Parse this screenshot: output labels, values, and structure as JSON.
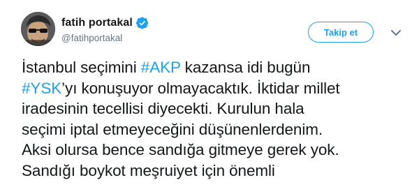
{
  "user": {
    "display_name": "fatih portakal",
    "handle": "@fatihportakal",
    "verified_icon": "verified-badge-icon",
    "avatar_icon": "profile-avatar"
  },
  "actions": {
    "follow_label": "Takip et",
    "more_icon": "chevron-down-icon"
  },
  "tweet": {
    "line1_a": "İstanbul seçimini ",
    "line1_hashtag": "#AKP",
    "line1_b": " kazansa idi bugün",
    "line2_hashtag": "#YSK",
    "line2_b": "’yı konuşuyor olmayacaktık. İktidar millet",
    "line3": "iradesinin tecellisi diyecekti. Kurulun hala",
    "line4": "seçimi iptal etmeyeceğini düşünenlerdenim.",
    "line5": "Aksi olursa bence sandığa gitmeye gerek yok.",
    "line6": "Sandığı boykot meşruiyet için önemli"
  },
  "colors": {
    "link": "#1da1f2",
    "text": "#14171a",
    "secondary": "#657786"
  }
}
